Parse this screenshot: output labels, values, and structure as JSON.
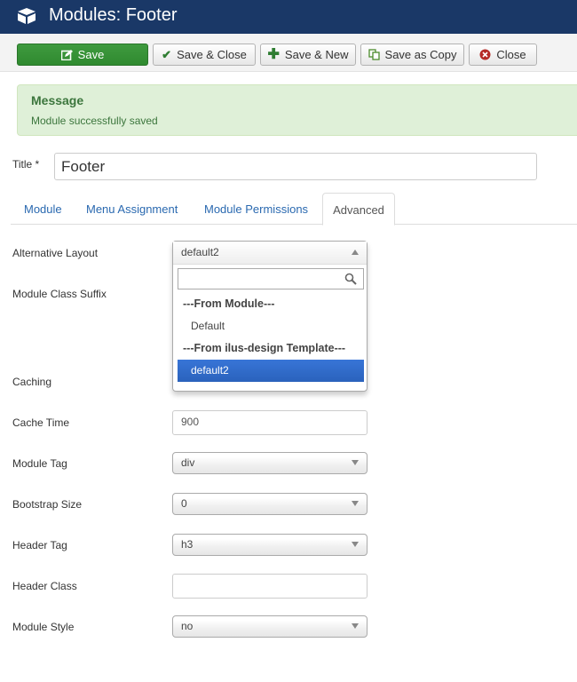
{
  "header": {
    "title": "Modules: Footer",
    "icon": "cube-icon"
  },
  "toolbar": {
    "save": "Save",
    "save_close": "Save & Close",
    "save_new": "Save & New",
    "save_copy": "Save as Copy",
    "close": "Close"
  },
  "message": {
    "heading": "Message",
    "text": "Module successfully saved"
  },
  "title_field": {
    "label": "Title *",
    "value": "Footer"
  },
  "tabs": [
    {
      "label": "Module"
    },
    {
      "label": "Menu Assignment"
    },
    {
      "label": "Module Permissions"
    },
    {
      "label": "Advanced",
      "active": true
    }
  ],
  "fields": {
    "alternative_layout": {
      "label": "Alternative Layout",
      "value": "default2",
      "search_value": "",
      "options": [
        {
          "label": "---From Module---",
          "group": true
        },
        {
          "label": "Default"
        },
        {
          "label": "---From ilus-design Template---",
          "group": true
        },
        {
          "label": "default2",
          "selected": true
        }
      ]
    },
    "module_class_suffix": {
      "label": "Module Class Suffix",
      "value": ""
    },
    "caching": {
      "label": "Caching"
    },
    "cache_time": {
      "label": "Cache Time",
      "value": "900"
    },
    "module_tag": {
      "label": "Module Tag",
      "value": "div"
    },
    "bootstrap_size": {
      "label": "Bootstrap Size",
      "value": "0"
    },
    "header_tag": {
      "label": "Header Tag",
      "value": "h3"
    },
    "header_class": {
      "label": "Header Class",
      "value": ""
    },
    "module_style": {
      "label": "Module Style",
      "value": "no"
    }
  },
  "colors": {
    "header_bg": "#1a3867",
    "save_green": "#3a963a",
    "alert_bg": "#dff0d8",
    "alert_text": "#3c763d",
    "link_blue": "#2a69b0",
    "highlight_blue": "#3875d7"
  }
}
